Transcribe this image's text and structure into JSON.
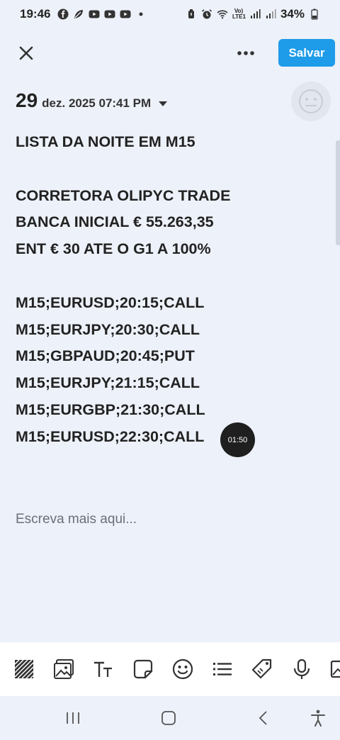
{
  "status_bar": {
    "time": "19:46",
    "battery_percent": "34%",
    "network_label": "Vo) LTE1",
    "left_icons": [
      "facebook-icon",
      "leaf-icon",
      "youtube-icon",
      "youtube-icon",
      "youtube-icon",
      "dot-icon"
    ],
    "right_icons": [
      "alarm-icon",
      "alarm-clock-icon",
      "wifi-icon",
      "signal-icon",
      "signal-icon",
      "battery-icon"
    ]
  },
  "header": {
    "close_icon": "close-icon",
    "more_icon": "more-dots-icon",
    "save_label": "Salvar",
    "save_color": "#1e9be9"
  },
  "entry": {
    "date_day": "29",
    "date_rest": "dez. 2025 07:41 PM",
    "mood_icon": "neutral-face-icon"
  },
  "note": {
    "lines": [
      "LISTA DA NOITE EM M15",
      "",
      "CORRETORA OLIPYC TRADE",
      "BANCA INICIAL € 55.263,35",
      "ENT € 30 ATE O G1 A 100%",
      "",
      "M15;EURUSD;20:15;CALL",
      "M15;EURJPY;20:30;CALL",
      "M15;GBPAUD;20:45;PUT",
      "M15;EURJPY;21:15;CALL",
      "M15;EURGBP;21:30;CALL",
      "M15;EURUSD;22:30;CALL"
    ],
    "timer_badge": "01:50",
    "placeholder": "Escreva mais aqui..."
  },
  "toolbar": {
    "tools": [
      "pattern-icon",
      "image-icon",
      "text-format-icon",
      "sticker-icon",
      "emoji-icon",
      "list-icon",
      "tag-icon",
      "microphone-icon",
      "gallery-icon"
    ]
  },
  "nav": {
    "icons": [
      "recent-apps-icon",
      "home-icon",
      "back-icon",
      "accessibility-icon"
    ]
  },
  "colors": {
    "background": "#edf1f9",
    "accent": "#1e9be9",
    "text": "#222222"
  }
}
